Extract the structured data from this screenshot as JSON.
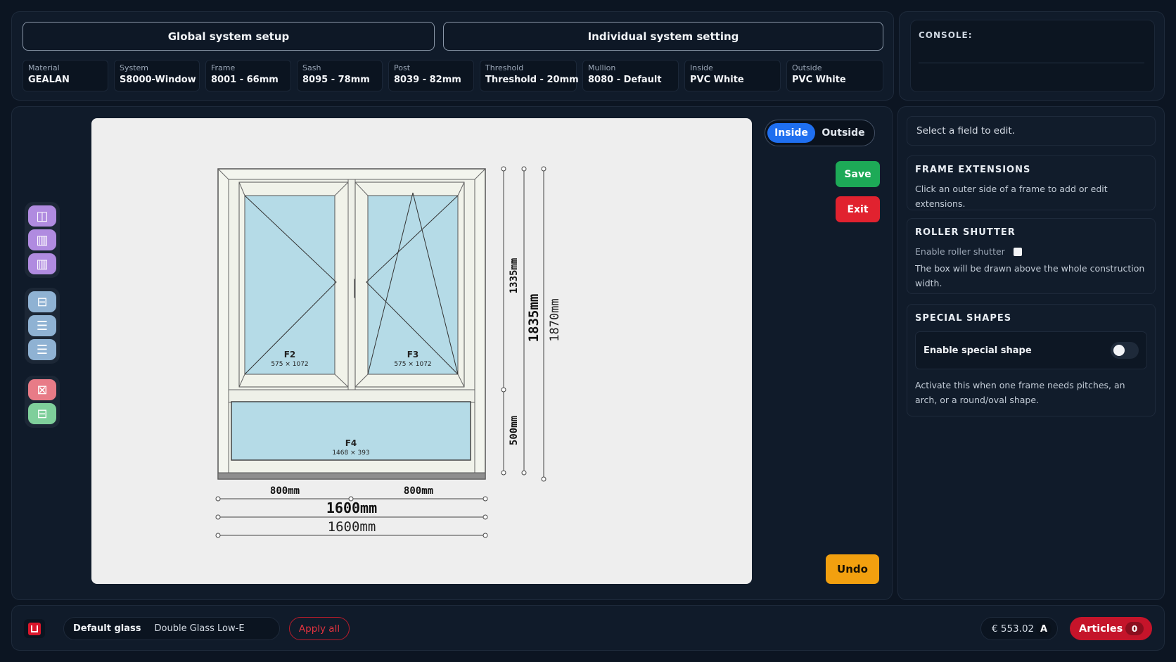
{
  "tabs": {
    "global": "Global system setup",
    "individual": "Individual system setting"
  },
  "fields": [
    {
      "label": "Material",
      "value": "GEALAN"
    },
    {
      "label": "System",
      "value": "S8000-Window"
    },
    {
      "label": "Frame",
      "value": "8001 - 66mm"
    },
    {
      "label": "Sash",
      "value": "8095 - 78mm"
    },
    {
      "label": "Post",
      "value": "8039 - 82mm"
    },
    {
      "label": "Threshold",
      "value": "Threshold - 20mm"
    },
    {
      "label": "Mullion",
      "value": "8080 - Default"
    },
    {
      "label": "Inside",
      "value": "PVC White"
    },
    {
      "label": "Outside",
      "value": "PVC White"
    }
  ],
  "console": {
    "title": "CONSOLE:"
  },
  "view_toggle": {
    "inside": "Inside",
    "outside": "Outside",
    "active": "inside"
  },
  "actions": {
    "save": "Save",
    "exit": "Exit",
    "undo": "Undo"
  },
  "drawing": {
    "sashes": [
      {
        "id": "F2",
        "size": "575 × 1072"
      },
      {
        "id": "F3",
        "size": "575 × 1072"
      },
      {
        "id": "F4",
        "size": "1468 × 393"
      }
    ],
    "dims": {
      "top_height": "1335mm",
      "bottom_height": "500mm",
      "inner_height": "1835mm",
      "total_height": "1870mm",
      "left_width": "800mm",
      "right_width": "800mm",
      "total_width_1": "1600mm",
      "total_width_2": "1600mm"
    }
  },
  "side": {
    "hint": "Select a field to edit.",
    "frame_ext": {
      "title": "FRAME EXTENSIONS",
      "text": "Click an outer side of a frame to add or edit extensions."
    },
    "roller": {
      "title": "ROLLER SHUTTER",
      "enable": "Enable roller shutter",
      "text": "The box will be drawn above the whole construction width."
    },
    "shapes": {
      "title": "SPECIAL SHAPES",
      "enable": "Enable special shape",
      "text": "Activate this when one frame needs pitches, an arch, or a round/oval shape."
    }
  },
  "bottom": {
    "default_glass_label": "Default glass",
    "glass_value": "Double Glass Low-E",
    "apply_all": "Apply all",
    "price": "€ 553.02",
    "price_badge": "A",
    "articles": "Articles",
    "articles_count": "0"
  },
  "colors": {
    "accent": "#1f6ff0",
    "save": "#1daa57",
    "exit": "#e1222f",
    "undo": "#f2a00f",
    "articles": "#c5142a"
  }
}
